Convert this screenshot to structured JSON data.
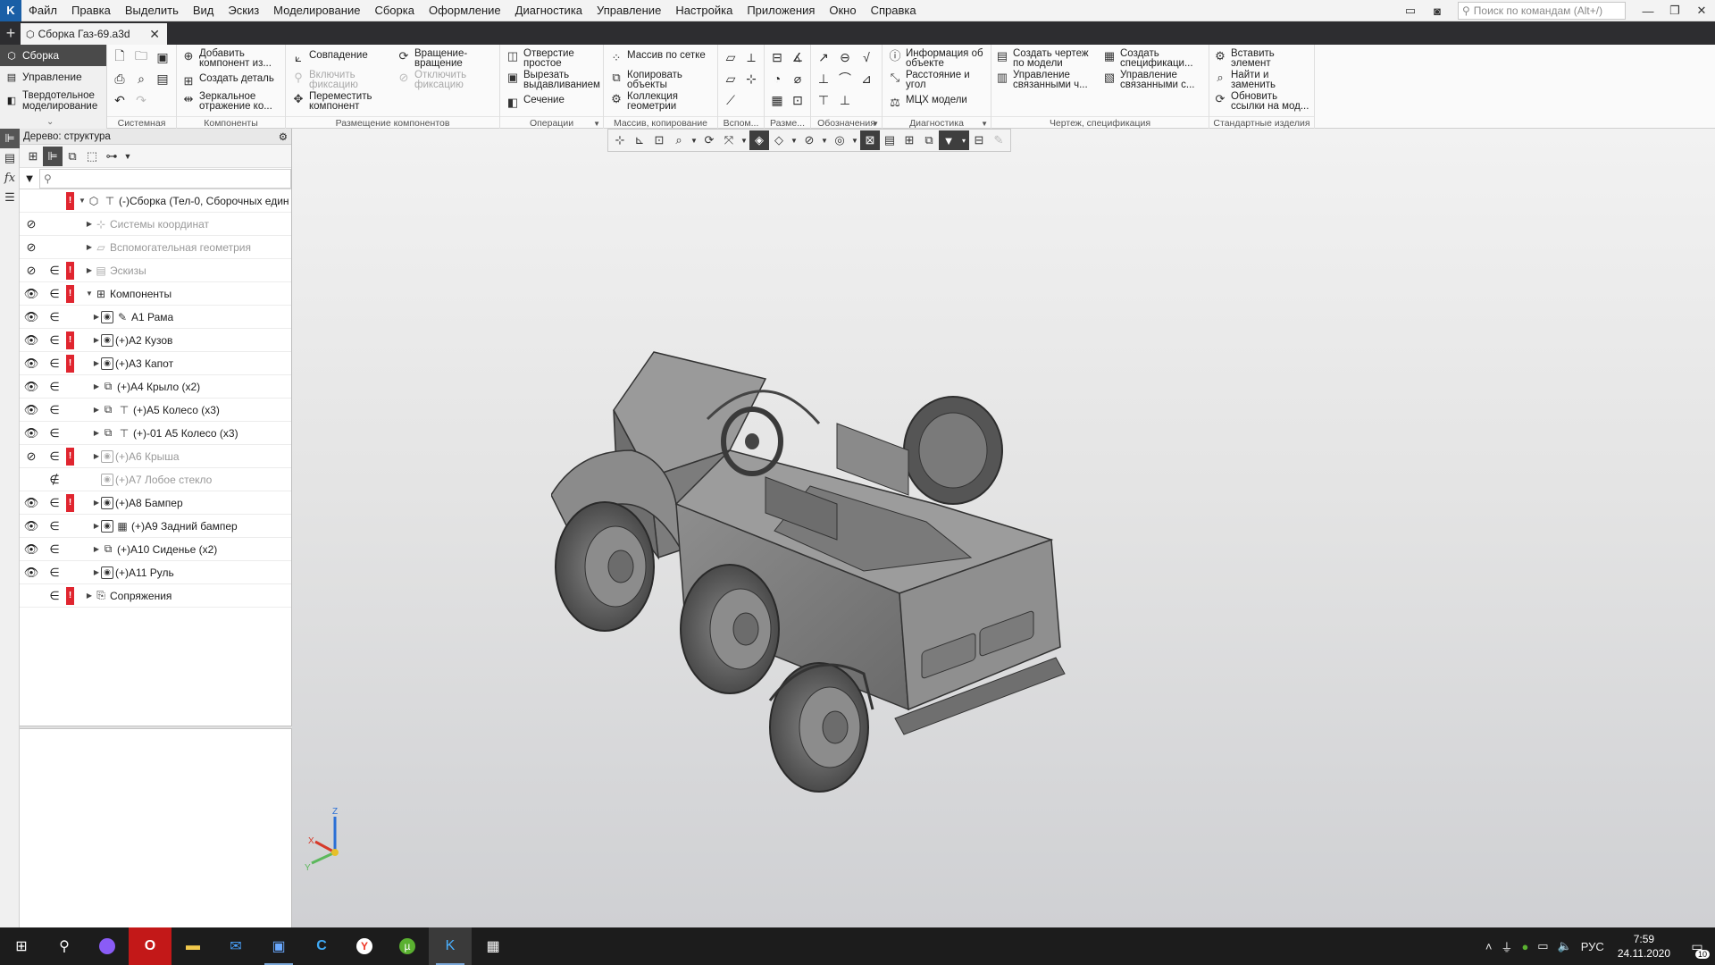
{
  "menu": {
    "items": [
      "Файл",
      "Правка",
      "Выделить",
      "Вид",
      "Эскиз",
      "Моделирование",
      "Сборка",
      "Оформление",
      "Диагностика",
      "Управление",
      "Настройка",
      "Приложения",
      "Окно",
      "Справка"
    ],
    "search_placeholder": "Поиск по командам (Alt+/)"
  },
  "tab": {
    "title": "Сборка Газ-69.a3d"
  },
  "modes": {
    "assembly": "Сборка",
    "management": "Управление",
    "solid": "Твердотельное моделирование"
  },
  "ribbon": {
    "system": {
      "title": "Системная"
    },
    "components": {
      "title": "Компоненты",
      "add": "Добавить компонент из...",
      "create_part": "Создать деталь",
      "mirror": "Зеркальное отражение ко..."
    },
    "placement": {
      "title": "Размещение компонентов",
      "match": "Совпадение",
      "enable_fix": "Включить фиксацию",
      "move": "Переместить компонент",
      "rotate": "Вращение-вращение",
      "disable_fix": "Отключить фиксацию"
    },
    "operations": {
      "title": "Операции",
      "hole": "Отверстие простое",
      "cut_extrude": "Вырезать выдавливанием",
      "section": "Сечение"
    },
    "pattern": {
      "title": "Массив, копирование",
      "grid": "Массив по сетке",
      "copy": "Копировать объекты",
      "collection": "Коллекция геометрии"
    },
    "aux": {
      "title": "Вспом..."
    },
    "dims": {
      "title": "Разме..."
    },
    "notation": {
      "title": "Обозначения"
    },
    "diagnostics": {
      "title": "Диагностика",
      "info": "Информация об объекте",
      "distance": "Расстояние и угол",
      "mass": "МЦХ модели"
    },
    "drawing": {
      "title": "Чертеж, спецификация",
      "create_drawing": "Создать чертеж по модели",
      "manage_linked": "Управление связанными ч...",
      "create_spec": "Создать спецификаци...",
      "manage_linked_spec": "Управление связанными с..."
    },
    "standard": {
      "title": "Стандартные изделия",
      "insert": "Вставить элемент",
      "find_replace": "Найти и заменить",
      "update_links": "Обновить ссылки на мод..."
    }
  },
  "tree": {
    "title": "Дерево: структура",
    "search_placeholder": "",
    "root": "(-)Сборка (Тел-0, Сборочных един",
    "rows": [
      {
        "label": "Системы координат",
        "dim": true
      },
      {
        "label": "Вспомогательная геометрия",
        "dim": true
      },
      {
        "label": "Эскизы",
        "dim": true
      },
      {
        "label": "Компоненты",
        "dim": false
      },
      {
        "label": "А1 Рама",
        "dim": false
      },
      {
        "label": "(+)А2 Кузов",
        "dim": false
      },
      {
        "label": "(+)А3 Капот",
        "dim": false
      },
      {
        "label": "(+)А4 Крыло (x2)",
        "dim": false
      },
      {
        "label": "(+)А5 Колесо (x3)",
        "dim": false
      },
      {
        "label": "(+)-01 А5 Колесо (x3)",
        "dim": false
      },
      {
        "label": "(+)А6 Крыша",
        "dim": true
      },
      {
        "label": "(+)А7 Лобое стекло",
        "dim": true
      },
      {
        "label": "(+)А8 Бампер",
        "dim": false
      },
      {
        "label": "(+)А9 Задний бампер",
        "dim": false
      },
      {
        "label": "(+)А10 Сиденье (x2)",
        "dim": false
      },
      {
        "label": "(+)А11 Руль",
        "dim": false
      },
      {
        "label": "Сопряжения",
        "dim": false
      }
    ]
  },
  "triad": {
    "x": "X",
    "y": "Y",
    "z": "Z"
  },
  "taskbar": {
    "lang": "РУС",
    "time": "7:59",
    "date": "24.11.2020",
    "notifications": "10"
  }
}
